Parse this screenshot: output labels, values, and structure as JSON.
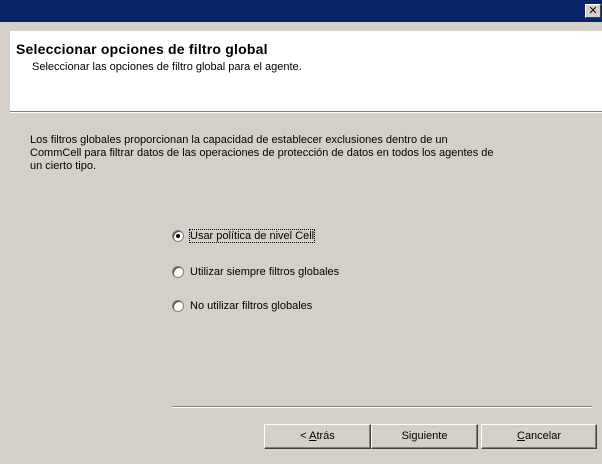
{
  "window": {
    "close_glyph": "✕",
    "title_bar_color": "#0a246a"
  },
  "header": {
    "title": "Seleccionar opciones de filtro global",
    "subtitle": "Seleccionar las opciones de filtro global para el agente."
  },
  "body": {
    "description_line1": "Los filtros globales proporcionan la capacidad de establecer exclusiones dentro de un",
    "description_line2": "CommCell para filtrar datos de las operaciones de protección de datos en todos los agentes de",
    "description_line3": "un cierto tipo."
  },
  "options": {
    "selected_index": 0,
    "items": [
      {
        "label": "Usar política de nivel Cell",
        "selected": true
      },
      {
        "label": "Utilizar siempre filtros globales",
        "selected": false
      },
      {
        "label": "No utilizar filtros globales",
        "selected": false
      }
    ]
  },
  "buttons": {
    "back_prefix": "< ",
    "back_mnemonic": "A",
    "back_rest": "trás",
    "next_label": "Siguiente",
    "cancel_mnemonic": "C",
    "cancel_rest": "ancelar"
  }
}
